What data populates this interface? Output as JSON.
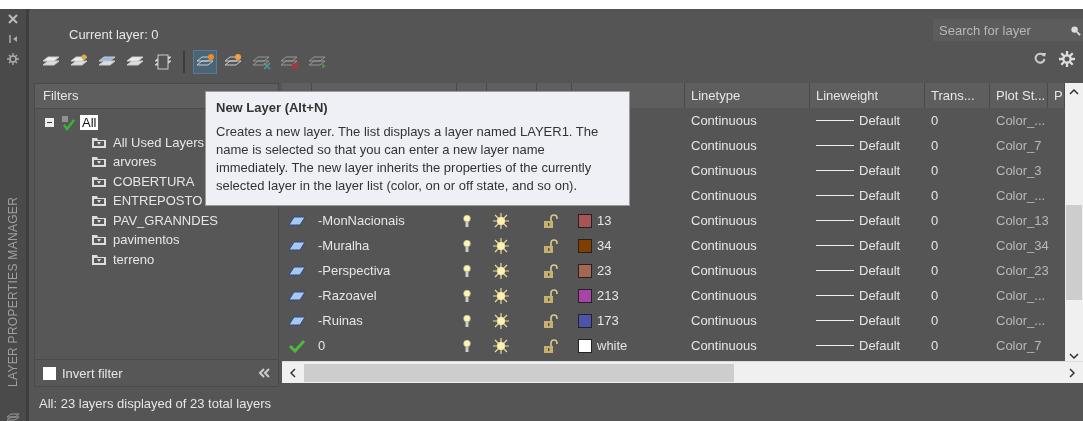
{
  "side_title": "LAYER PROPERTIES MANAGER",
  "current_layer": "Current layer: 0",
  "search": {
    "placeholder": "Search for layer"
  },
  "toolbar": [
    [
      {
        "selected": false,
        "disabled": false
      },
      {
        "selected": false,
        "disabled": false
      },
      {
        "selected": false,
        "disabled": false
      },
      {
        "selected": false,
        "disabled": false
      },
      {
        "selected": false,
        "disabled": false
      }
    ],
    [
      {
        "selected": true,
        "disabled": false
      },
      {
        "selected": false,
        "disabled": false
      },
      {
        "selected": false,
        "disabled": true
      },
      {
        "selected": false,
        "disabled": true
      },
      {
        "selected": false,
        "disabled": true
      }
    ]
  ],
  "filters": {
    "title": "Filters",
    "tree": [
      {
        "label": "All",
        "selected": true,
        "expanded": true,
        "children": [
          {
            "label": "All Used Layers",
            "selected": false
          },
          {
            "label": "arvores",
            "selected": false
          },
          {
            "label": "COBERTURA",
            "selected": false
          },
          {
            "label": "ENTREPOSTO",
            "selected": false
          },
          {
            "label": "PAV_GRANNDES",
            "selected": false
          },
          {
            "label": "pavimentos",
            "selected": false
          },
          {
            "label": "terreno",
            "selected": false
          }
        ]
      }
    ],
    "invert_filter": {
      "label": "Invert filter",
      "checked": false
    }
  },
  "table": {
    "columns": [
      "Linetype",
      "Lineweight",
      "Trans...",
      "Plot St...",
      "P"
    ],
    "rows": [
      {
        "linetype": "Continuous",
        "lineweight": "Default",
        "transparency": "0",
        "plot_style": "Color_..."
      },
      {
        "linetype": "Continuous",
        "lineweight": "Default",
        "transparency": "0",
        "plot_style": "Color_7"
      },
      {
        "linetype": "Continuous",
        "lineweight": "Default",
        "transparency": "0",
        "plot_style": "Color_3"
      },
      {
        "linetype": "Continuous",
        "lineweight": "Default",
        "transparency": "0",
        "plot_style": "Color_..."
      },
      {
        "current": false,
        "name": "-MonNacionais",
        "on": true,
        "frozen": false,
        "locked": false,
        "color": "#a85454",
        "color_name": "13",
        "linetype": "Continuous",
        "lineweight": "Default",
        "transparency": "0",
        "plot_style": "Color_13"
      },
      {
        "current": false,
        "name": "-Muralha",
        "on": true,
        "frozen": false,
        "locked": false,
        "color": "#7f3f00",
        "color_name": "34",
        "linetype": "Continuous",
        "lineweight": "Default",
        "transparency": "0",
        "plot_style": "Color_34"
      },
      {
        "current": false,
        "name": "-Perspectiva",
        "on": true,
        "frozen": false,
        "locked": false,
        "color": "#a5674f",
        "color_name": "23",
        "linetype": "Continuous",
        "lineweight": "Default",
        "transparency": "0",
        "plot_style": "Color_23"
      },
      {
        "current": false,
        "name": "-Razoavel",
        "on": true,
        "frozen": false,
        "locked": false,
        "color": "#a844a8",
        "color_name": "213",
        "linetype": "Continuous",
        "lineweight": "Default",
        "transparency": "0",
        "plot_style": "Color_..."
      },
      {
        "current": false,
        "name": "-Ruinas",
        "on": true,
        "frozen": false,
        "locked": false,
        "color": "#4c54a8",
        "color_name": "173",
        "linetype": "Continuous",
        "lineweight": "Default",
        "transparency": "0",
        "plot_style": "Color_..."
      },
      {
        "current": true,
        "name": "0",
        "on": true,
        "frozen": false,
        "locked": false,
        "color": "#ffffff",
        "color_name": "white",
        "linetype": "Continuous",
        "lineweight": "Default",
        "transparency": "0",
        "plot_style": "Color_7"
      }
    ]
  },
  "tooltip": {
    "title": "New Layer (Alt+N)",
    "text": "Creates a new layer. The list displays a layer named LAYER1. The name is selected so that you can enter a new layer name immediately. The new layer inherits the properties of the currently selected layer in the layer list (color, on or off state, and so on)."
  },
  "status": "All: 23 layers displayed of 23 total layers"
}
